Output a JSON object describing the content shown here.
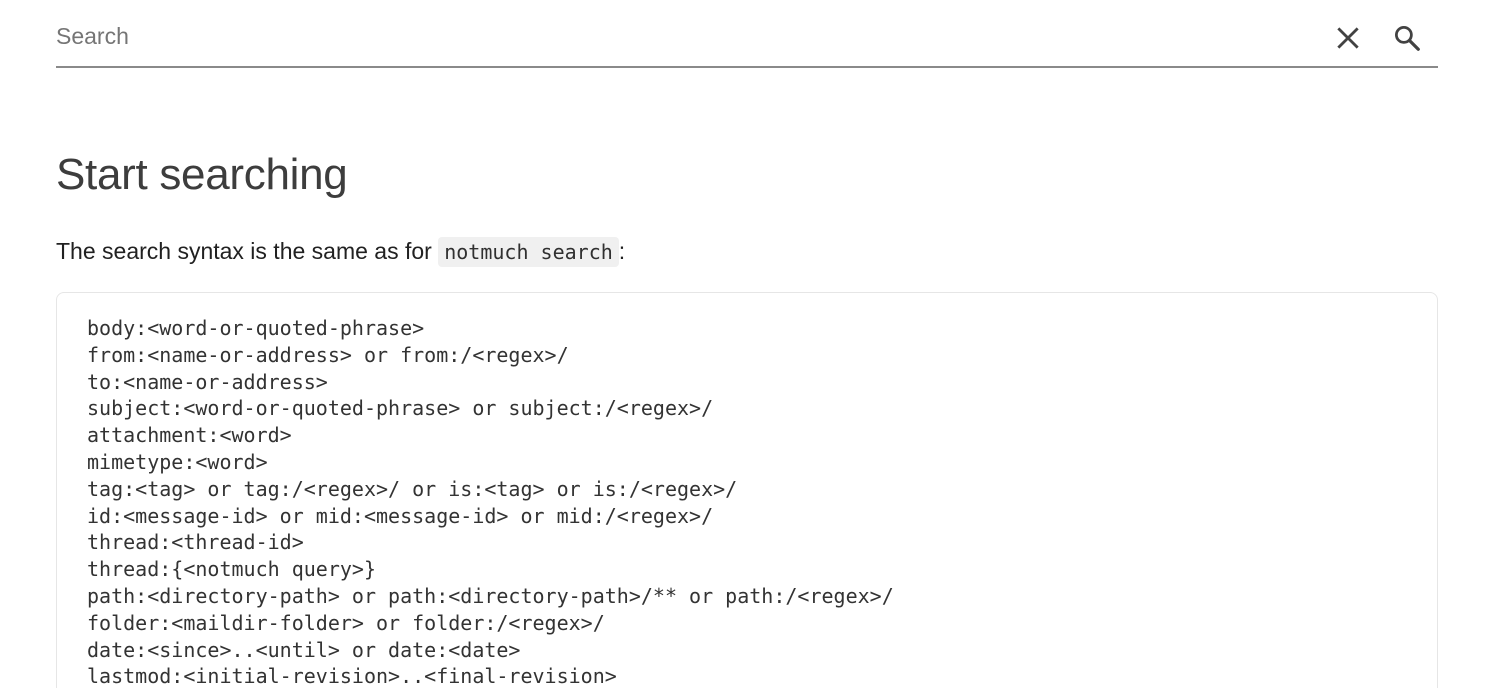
{
  "search": {
    "placeholder": "Search",
    "value": "",
    "clear_icon": "close-icon",
    "search_icon": "search-icon"
  },
  "main": {
    "title": "Start searching",
    "intro_before": "The search syntax is the same as for ",
    "intro_code": "notmuch search",
    "intro_after": ":",
    "syntax_lines": [
      "body:<word-or-quoted-phrase>",
      "from:<name-or-address> or from:/<regex>/",
      "to:<name-or-address>",
      "subject:<word-or-quoted-phrase> or subject:/<regex>/",
      "attachment:<word>",
      "mimetype:<word>",
      "tag:<tag> or tag:/<regex>/ or is:<tag> or is:/<regex>/",
      "id:<message-id> or mid:<message-id> or mid:/<regex>/",
      "thread:<thread-id>",
      "thread:{<notmuch query>}",
      "path:<directory-path> or path:<directory-path>/** or path:/<regex>/",
      "folder:<maildir-folder> or folder:/<regex>/",
      "date:<since>..<until> or date:<date>",
      "lastmod:<initial-revision>..<final-revision>"
    ]
  },
  "colors": {
    "underline": "#8a8a8a",
    "title": "#3d3d3d",
    "code_bg": "#f0f0f0",
    "block_border": "#e6e6e6"
  }
}
